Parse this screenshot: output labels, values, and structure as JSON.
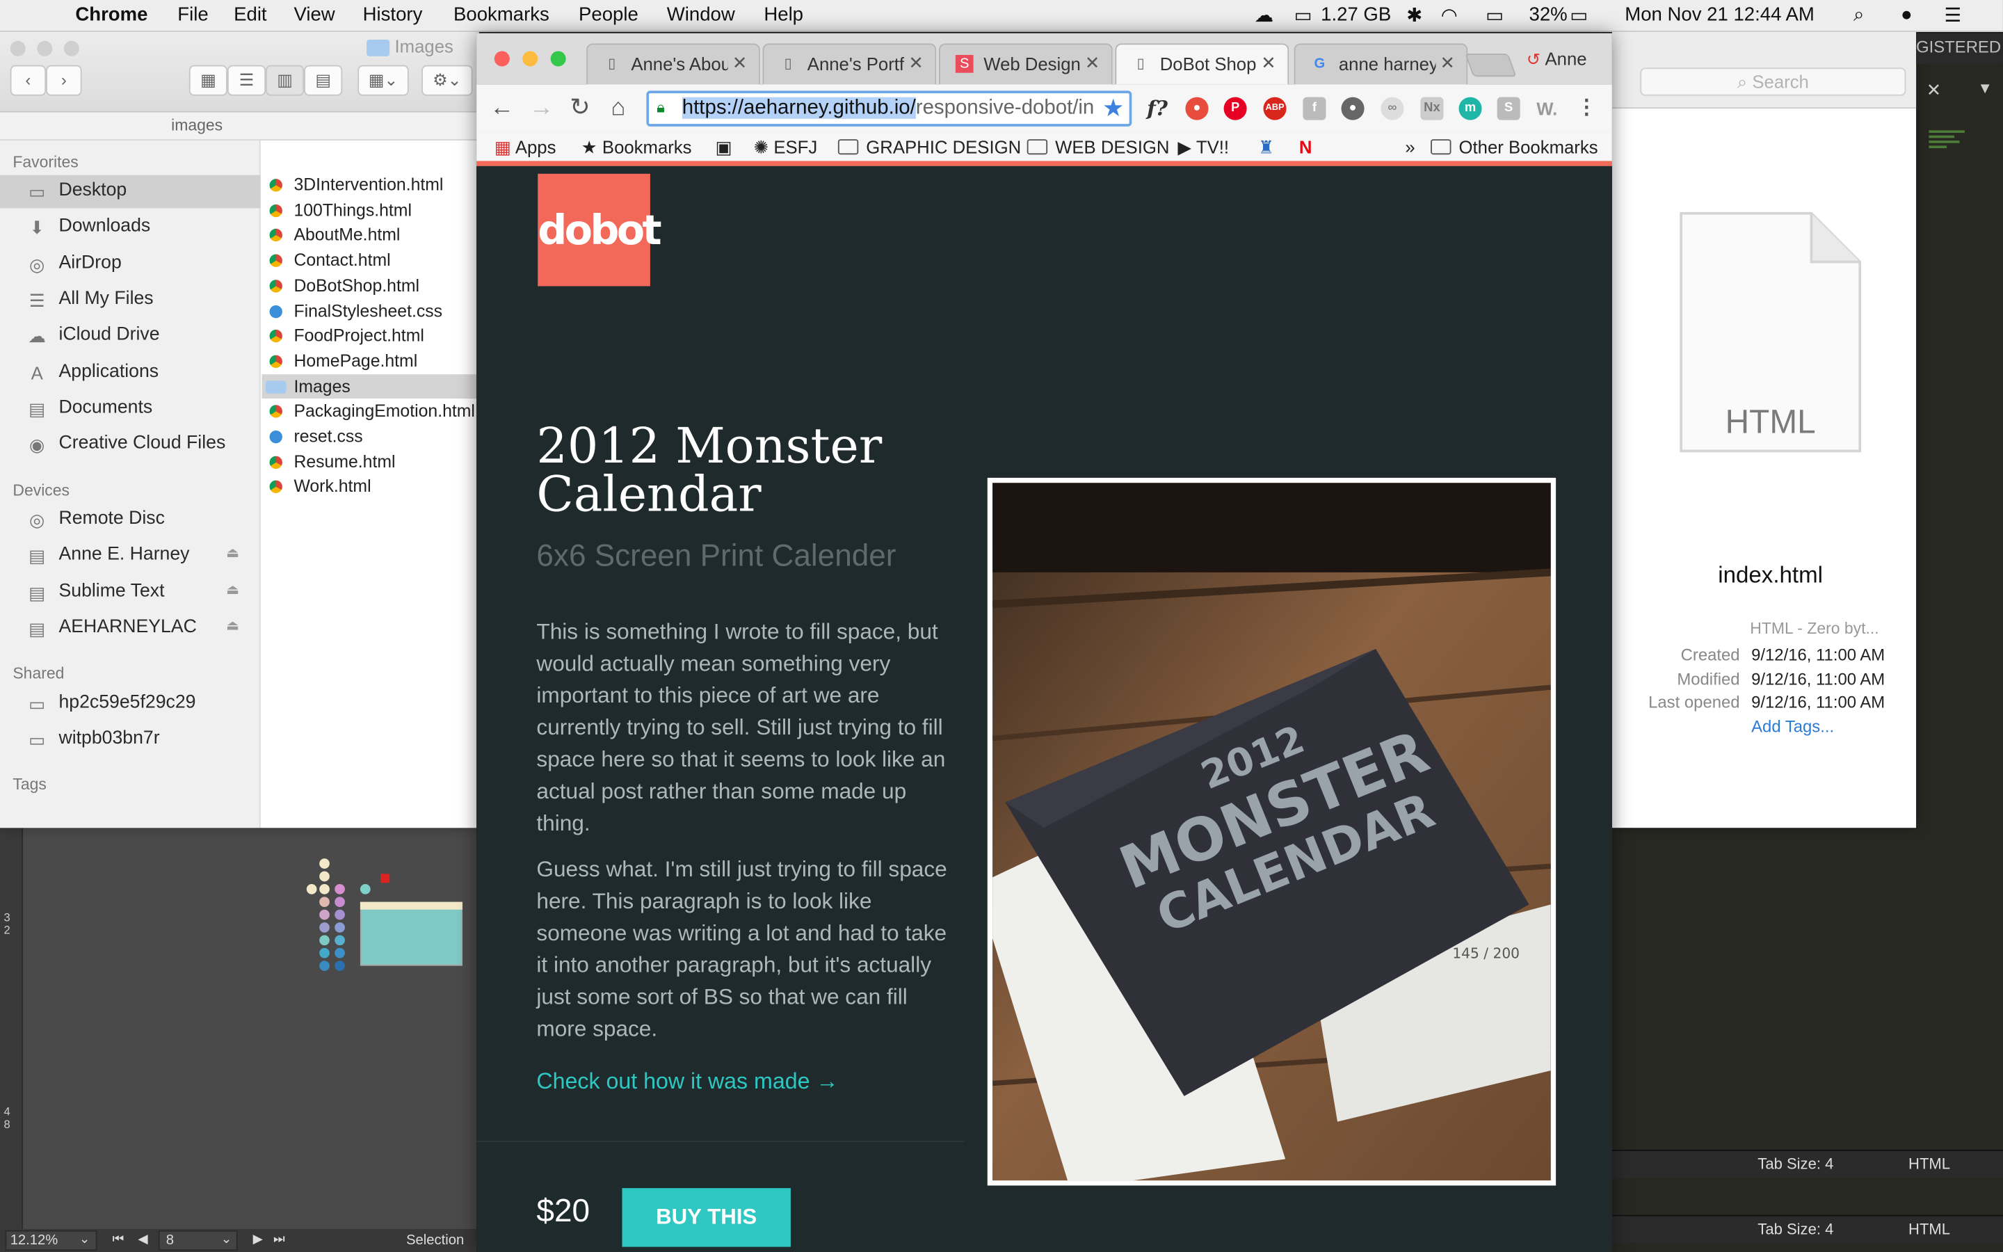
{
  "menubar": {
    "app": "Chrome",
    "items": [
      "File",
      "Edit",
      "View",
      "History",
      "Bookmarks",
      "People",
      "Window",
      "Help"
    ],
    "memory": "1.27 GB",
    "battery": "32%",
    "clock": "Mon Nov 21  12:44 AM"
  },
  "finder": {
    "title": "Images",
    "path_label": "images",
    "sections": {
      "favorites": "Favorites",
      "devices": "Devices",
      "shared": "Shared",
      "tags": "Tags"
    },
    "favorites": [
      "Desktop",
      "Downloads",
      "AirDrop",
      "All My Files",
      "iCloud Drive",
      "Applications",
      "Documents",
      "Creative Cloud Files"
    ],
    "devices": [
      "Remote Disc",
      "Anne E. Harney",
      "Sublime Text",
      "AEHARNEYLAC"
    ],
    "shared": [
      "hp2c59e5f29c29",
      "witpb03bn7r"
    ],
    "files": [
      "3DIntervention.html",
      "100Things.html",
      "AboutMe.html",
      "Contact.html",
      "DoBotShop.html",
      "FinalStylesheet.css",
      "FoodProject.html",
      "HomePage.html",
      "Images",
      "PackagingEmotion.html",
      "reset.css",
      "Resume.html",
      "Work.html"
    ]
  },
  "chrome": {
    "tabs": [
      {
        "title": "Anne's About",
        "icon": "page-icon"
      },
      {
        "title": "Anne's Portfolio",
        "icon": "page-icon"
      },
      {
        "title": "Web Design",
        "icon": "s-icon"
      },
      {
        "title": "DoBot Shop",
        "icon": "page-icon"
      },
      {
        "title": "anne harney",
        "icon": "google-icon"
      }
    ],
    "profile": "Anne",
    "url_selected": "https://aeharney.github.io/",
    "url_rest": "responsive-dobot/in",
    "bookmarks": {
      "apps": "Apps",
      "bookmarks": "Bookmarks",
      "esfj": "ESFJ",
      "graphic": "GRAPHIC DESIGN",
      "web": "WEB DESIGN",
      "tv": "TV!!",
      "chevron": "»",
      "other": "Other Bookmarks"
    }
  },
  "page": {
    "logo": "dobot",
    "title": "2012 Monster Calendar",
    "subtitle": "6x6 Screen Print Calender",
    "paragraph1": "This is something I wrote to fill space, but would actually mean something very important to this piece of art we are currently trying to sell. Still just trying to fill space here so that it seems to look like an actual post rather than some made up thing.",
    "paragraph2": "Guess what. I'm still just trying to fill space here. This paragraph is to look like someone was writing a lot and had to take it into another paragraph, but it's actually just some sort of BS so that we can fill more space.",
    "link": "Check out how it was made →",
    "price": "$20",
    "buy": "BUY THIS",
    "photo_text": {
      "year": "2012",
      "line1": "MONSTER",
      "line2": "CALENDAR",
      "edition": "145 / 200"
    }
  },
  "info": {
    "registered": "GISTERED",
    "search_placeholder": "Search",
    "doc_type": "HTML",
    "filename": "index.html",
    "kind": "HTML - Zero byt...",
    "created_label": "Created",
    "created": "9/12/16, 11:00 AM",
    "modified_label": "Modified",
    "modified": "9/12/16, 11:00 AM",
    "opened_label": "Last opened",
    "opened": "9/12/16, 11:00 AM",
    "add_tags": "Add Tags..."
  },
  "sublime": {
    "tab_size": "Tab Size: 4",
    "syntax": "HTML"
  },
  "design": {
    "zoom": "12.12%",
    "page": "8",
    "tool": "Selection",
    "ruler": [
      "3",
      "2",
      "4",
      "8"
    ]
  }
}
